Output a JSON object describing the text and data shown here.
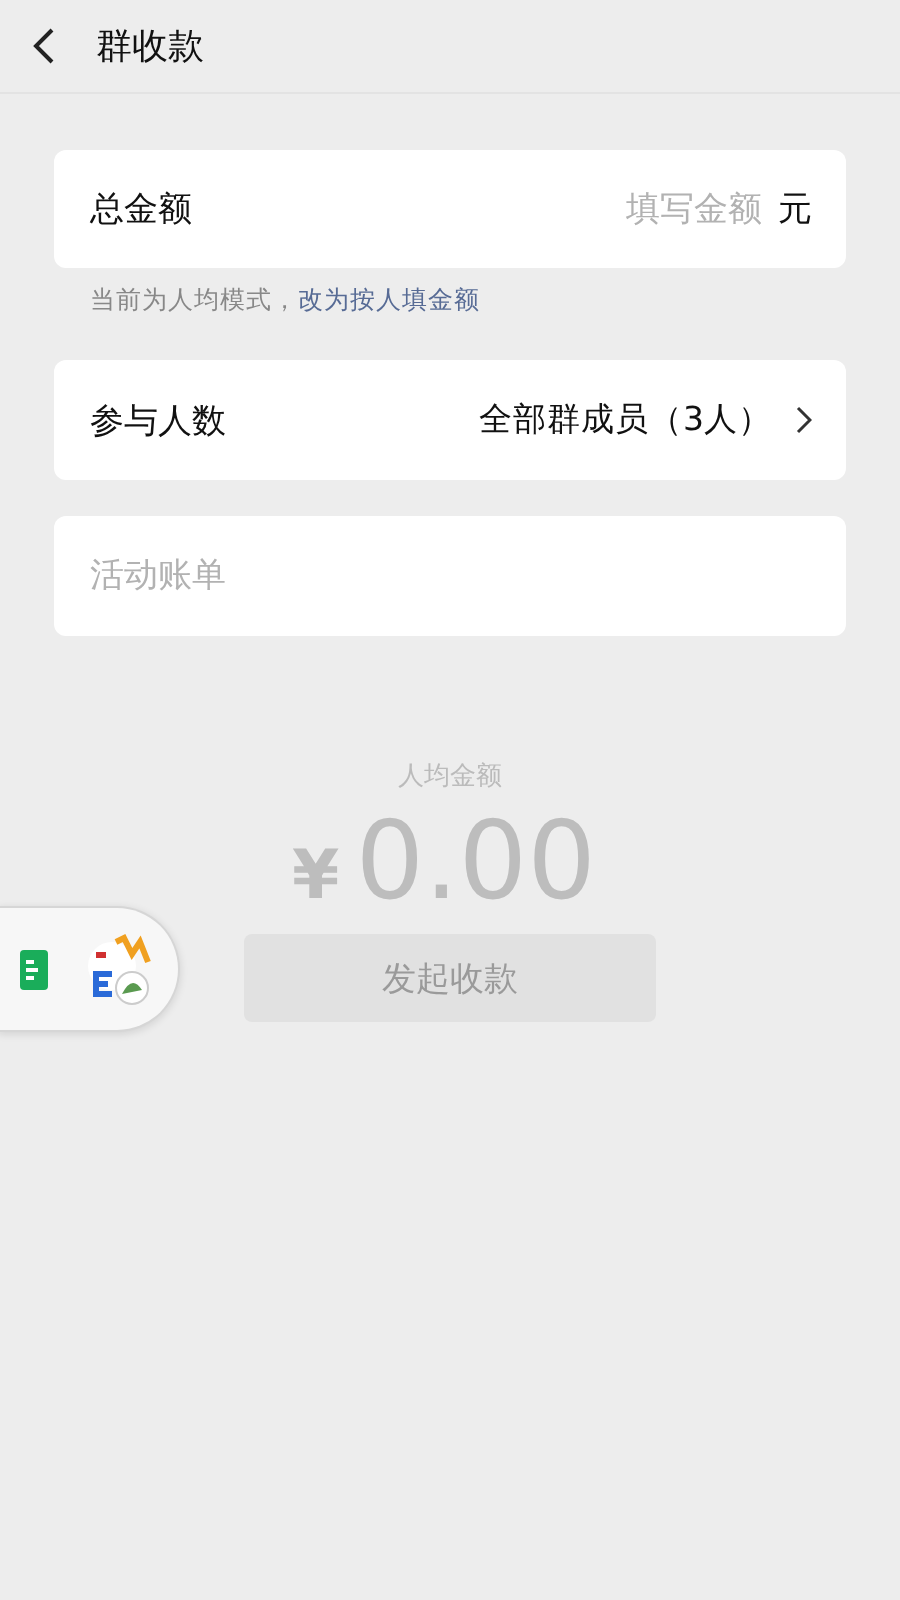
{
  "header": {
    "title": "群收款"
  },
  "total": {
    "label": "总金额",
    "placeholder": "填写金额",
    "unit": "元"
  },
  "mode_hint": {
    "text": "当前为人均模式，",
    "link": "改为按人填金额"
  },
  "participants": {
    "label": "参与人数",
    "value": "全部群成员（3人）"
  },
  "bill": {
    "placeholder": "活动账单"
  },
  "per_person": {
    "label": "人均金额",
    "currency": "¥",
    "amount": "0.00"
  },
  "submit": {
    "label": "发起收款",
    "disabled": true
  },
  "floating_bubble": {
    "expanded": true
  }
}
